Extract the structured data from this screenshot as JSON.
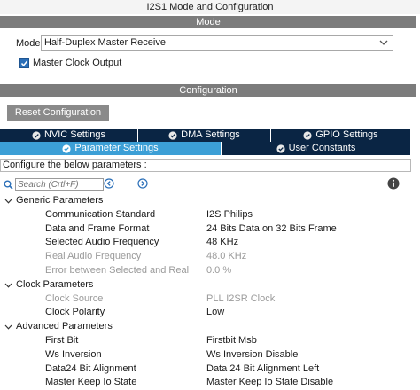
{
  "window": {
    "title": "I2S1 Mode and Configuration"
  },
  "mode_section": {
    "header": "Mode",
    "mode_label": "Mode",
    "mode_value": "Half-Duplex Master Receive",
    "master_clock_output": {
      "label": "Master Clock Output",
      "checked": true
    }
  },
  "config_section": {
    "header": "Configuration",
    "reset_label": "Reset Configuration",
    "tabs_row1": [
      {
        "label": "NVIC Settings"
      },
      {
        "label": "DMA Settings"
      },
      {
        "label": "GPIO Settings"
      }
    ],
    "tabs_row2": [
      {
        "label": "Parameter Settings",
        "active": true
      },
      {
        "label": "User Constants",
        "active": false
      }
    ],
    "description": "Configure the below parameters :",
    "search_placeholder": "Search (Crtl+F)"
  },
  "groups": [
    {
      "name": "Generic Parameters",
      "params": [
        {
          "key": "Communication Standard",
          "value": "I2S Philips",
          "enabled": true
        },
        {
          "key": "Data and Frame Format",
          "value": "24 Bits Data on 32 Bits Frame",
          "enabled": true
        },
        {
          "key": "Selected Audio Frequency",
          "value": "48 KHz",
          "enabled": true
        },
        {
          "key": "Real Audio Frequency",
          "value": "48.0 KHz",
          "enabled": false
        },
        {
          "key": "Error between Selected and Real",
          "value": "0.0 %",
          "enabled": false
        }
      ]
    },
    {
      "name": "Clock Parameters",
      "params": [
        {
          "key": "Clock Source",
          "value": "PLL I2SR Clock",
          "enabled": false
        },
        {
          "key": "Clock Polarity",
          "value": "Low",
          "enabled": true
        }
      ]
    },
    {
      "name": "Advanced Parameters",
      "params": [
        {
          "key": "First Bit",
          "value": "Firstbit Msb",
          "enabled": true
        },
        {
          "key": "Ws Inversion",
          "value": "Ws Inversion Disable",
          "enabled": true
        },
        {
          "key": "Data24 Bit Alignment",
          "value": "Data 24 Bit Alignment Left",
          "enabled": true
        },
        {
          "key": "Master Keep Io State",
          "value": "Master Keep Io State Disable",
          "enabled": true
        }
      ]
    }
  ],
  "colors": {
    "header_bar": "#7c7c7c",
    "tab_dark": "#0a2544",
    "tab_active": "#3c9fd6",
    "checkbox": "#2b6fb8",
    "disabled_text": "#9a9a9a"
  }
}
